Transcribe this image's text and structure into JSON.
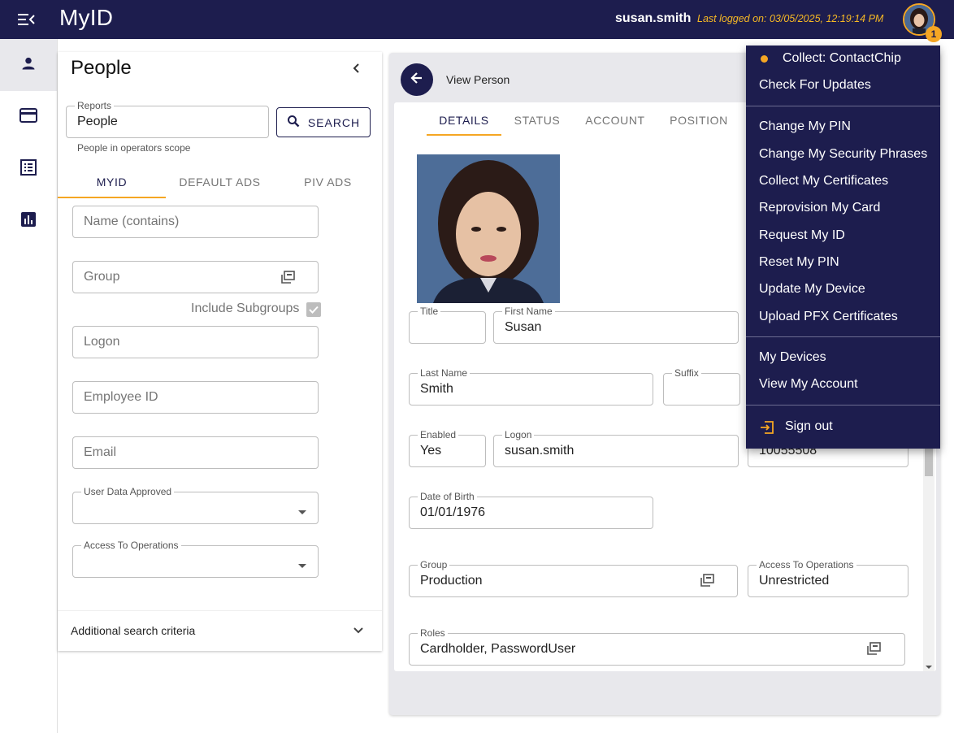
{
  "topbar": {
    "app_title": "MyID",
    "user_name": "susan.smith",
    "last_logged": "Last logged on: 03/05/2025, 12:19:14 PM",
    "notification_count": "1"
  },
  "people_panel": {
    "title": "People",
    "reports_label": "Reports",
    "reports_value": "People",
    "search_label": "SEARCH",
    "scope_hint": "People in operators scope",
    "tabs": [
      "MYID",
      "DEFAULT ADS",
      "PIV ADS"
    ],
    "name_placeholder": "Name (contains)",
    "group_placeholder": "Group",
    "include_subgroups": "Include Subgroups",
    "include_subgroups_checked": true,
    "logon_placeholder": "Logon",
    "employee_placeholder": "Employee ID",
    "email_placeholder": "Email",
    "user_data_label": "User Data Approved",
    "access_label": "Access To Operations",
    "additional": "Additional search criteria"
  },
  "person_view": {
    "title": "View Person",
    "tabs": [
      "DETAILS",
      "STATUS",
      "ACCOUNT",
      "POSITION"
    ],
    "fields": {
      "title_label": "Title",
      "title_value": "",
      "first_name_label": "First Name",
      "first_name_value": "Susan",
      "last_name_label": "Last Name",
      "last_name_value": "Smith",
      "suffix_label": "Suffix",
      "suffix_value": "",
      "enabled_label": "Enabled",
      "enabled_value": "Yes",
      "logon_label": "Logon",
      "logon_value": "susan.smith",
      "employee_partial": "10055508",
      "dob_label": "Date of Birth",
      "dob_value": "01/01/1976",
      "group_label": "Group",
      "group_value": "Production",
      "access_label": "Access To Operations",
      "access_value": "Unrestricted",
      "roles_label": "Roles",
      "roles_value": "Cardholder, PasswordUser"
    }
  },
  "user_menu": {
    "collect": "Collect: ContactChip",
    "check_updates": "Check For Updates",
    "items": [
      "Change My PIN",
      "Change My Security Phrases",
      "Collect My Certificates",
      "Reprovision My Card",
      "Request My ID",
      "Reset My PIN",
      "Update My Device",
      "Upload PFX Certificates"
    ],
    "devices": "My Devices",
    "view_account": "View My Account",
    "sign_out": "Sign out"
  },
  "colors": {
    "primary": "#1d1d4e",
    "accent": "#f5a623",
    "last_logged_text": "#f7b924"
  }
}
